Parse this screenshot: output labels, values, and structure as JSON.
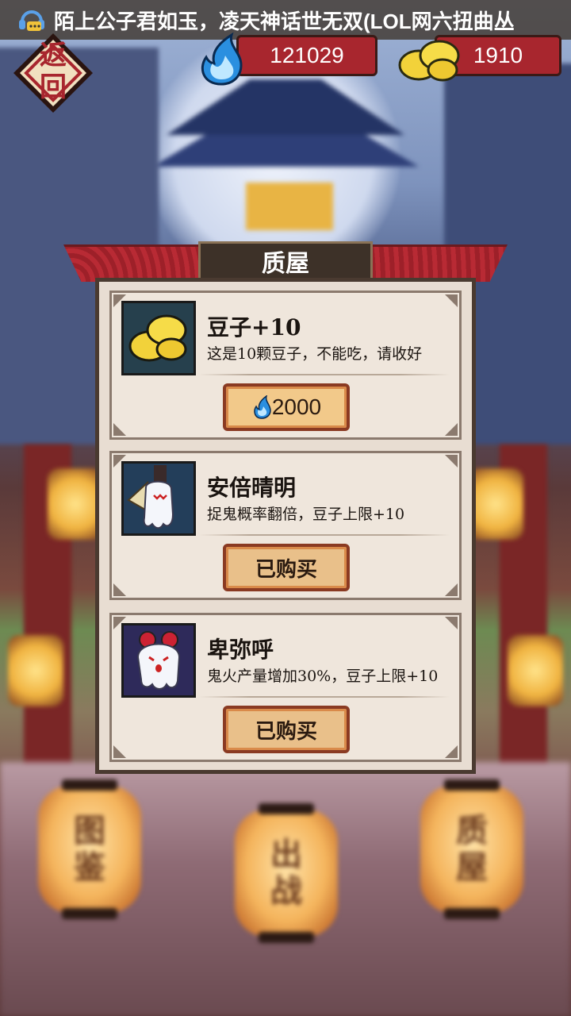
{
  "status_bar": {
    "marquee": "陌上公子君如玉，凌天神话世无双(LOL网六扭曲丛"
  },
  "header": {
    "back_label": "返回",
    "ghost_fire_amount": "121029",
    "beans_amount": "1910"
  },
  "shop": {
    "title": "质屋",
    "items": [
      {
        "name": "豆子+10",
        "desc": "这是10颗豆子，不能吃，请收好",
        "price": "2000",
        "button_label": ""
      },
      {
        "name": "安倍晴明",
        "desc": "捉鬼概率翻倍，豆子上限+10",
        "price": "",
        "button_label": "已购买"
      },
      {
        "name": "卑弥呼",
        "desc": "鬼火产量增加30%，豆子上限+10",
        "price": "",
        "button_label": "已购买"
      }
    ]
  },
  "bottom_nav": {
    "tabs": [
      {
        "label_line1": "图",
        "label_line2": "鉴"
      },
      {
        "label_line1": "出",
        "label_line2": "战"
      },
      {
        "label_line1": "质",
        "label_line2": "屋"
      }
    ]
  },
  "colors": {
    "accent_red": "#a8262e",
    "panel_bg": "#e8ddd2",
    "button_bg": "#f2c98a"
  }
}
